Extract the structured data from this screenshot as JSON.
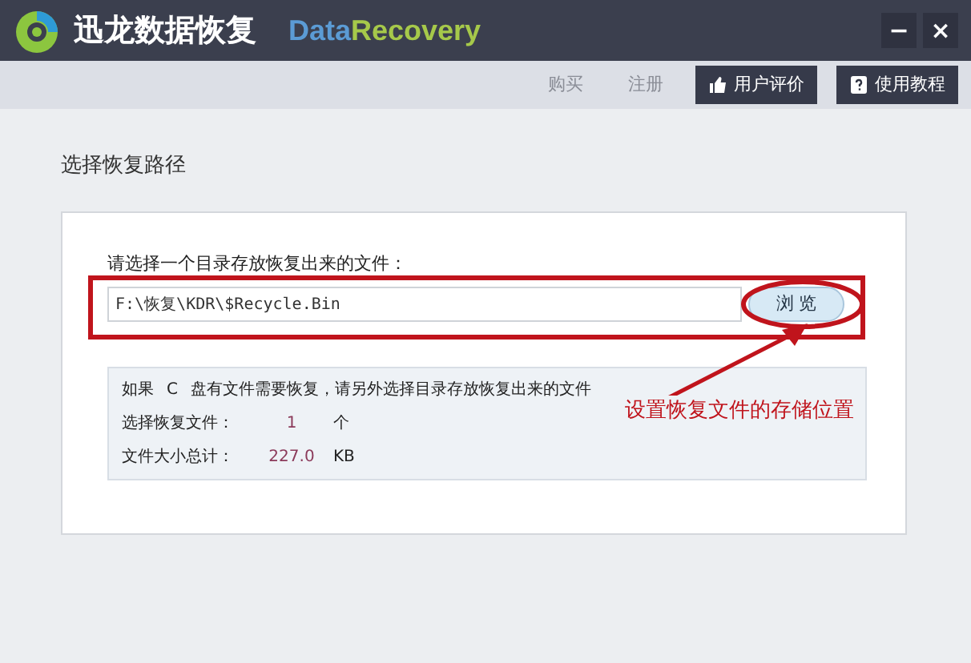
{
  "window": {
    "title": "迅龙数据恢复",
    "brand_part_1": "Data",
    "brand_part_2": "Recovery",
    "controls": [
      "−",
      "×"
    ]
  },
  "toolbar": {
    "links": [
      "购买",
      "注册"
    ],
    "buttons": [
      {
        "kind": "rating",
        "label": "用户评价"
      },
      {
        "kind": "help",
        "label": "使用教程"
      }
    ]
  },
  "section_title": "选择恢复路径",
  "path_prompt": "请选择一个目录存放恢复出来的文件：",
  "path_field": {
    "value": "F:\\恢复\\KDR\\$Recycle.Bin"
  },
  "browse_button": "浏 览",
  "info": {
    "note_parts": [
      "如果",
      "C",
      "盘有文件需要恢复，请另外选择目录存放恢复出来的文件"
    ],
    "rows": [
      {
        "label": "选择恢复文件：",
        "value": "1",
        "unit": "个"
      },
      {
        "label": "文件大小总计：",
        "value": "227.0",
        "unit": "KB"
      }
    ]
  },
  "annotation": "设置恢复文件的存储位置"
}
